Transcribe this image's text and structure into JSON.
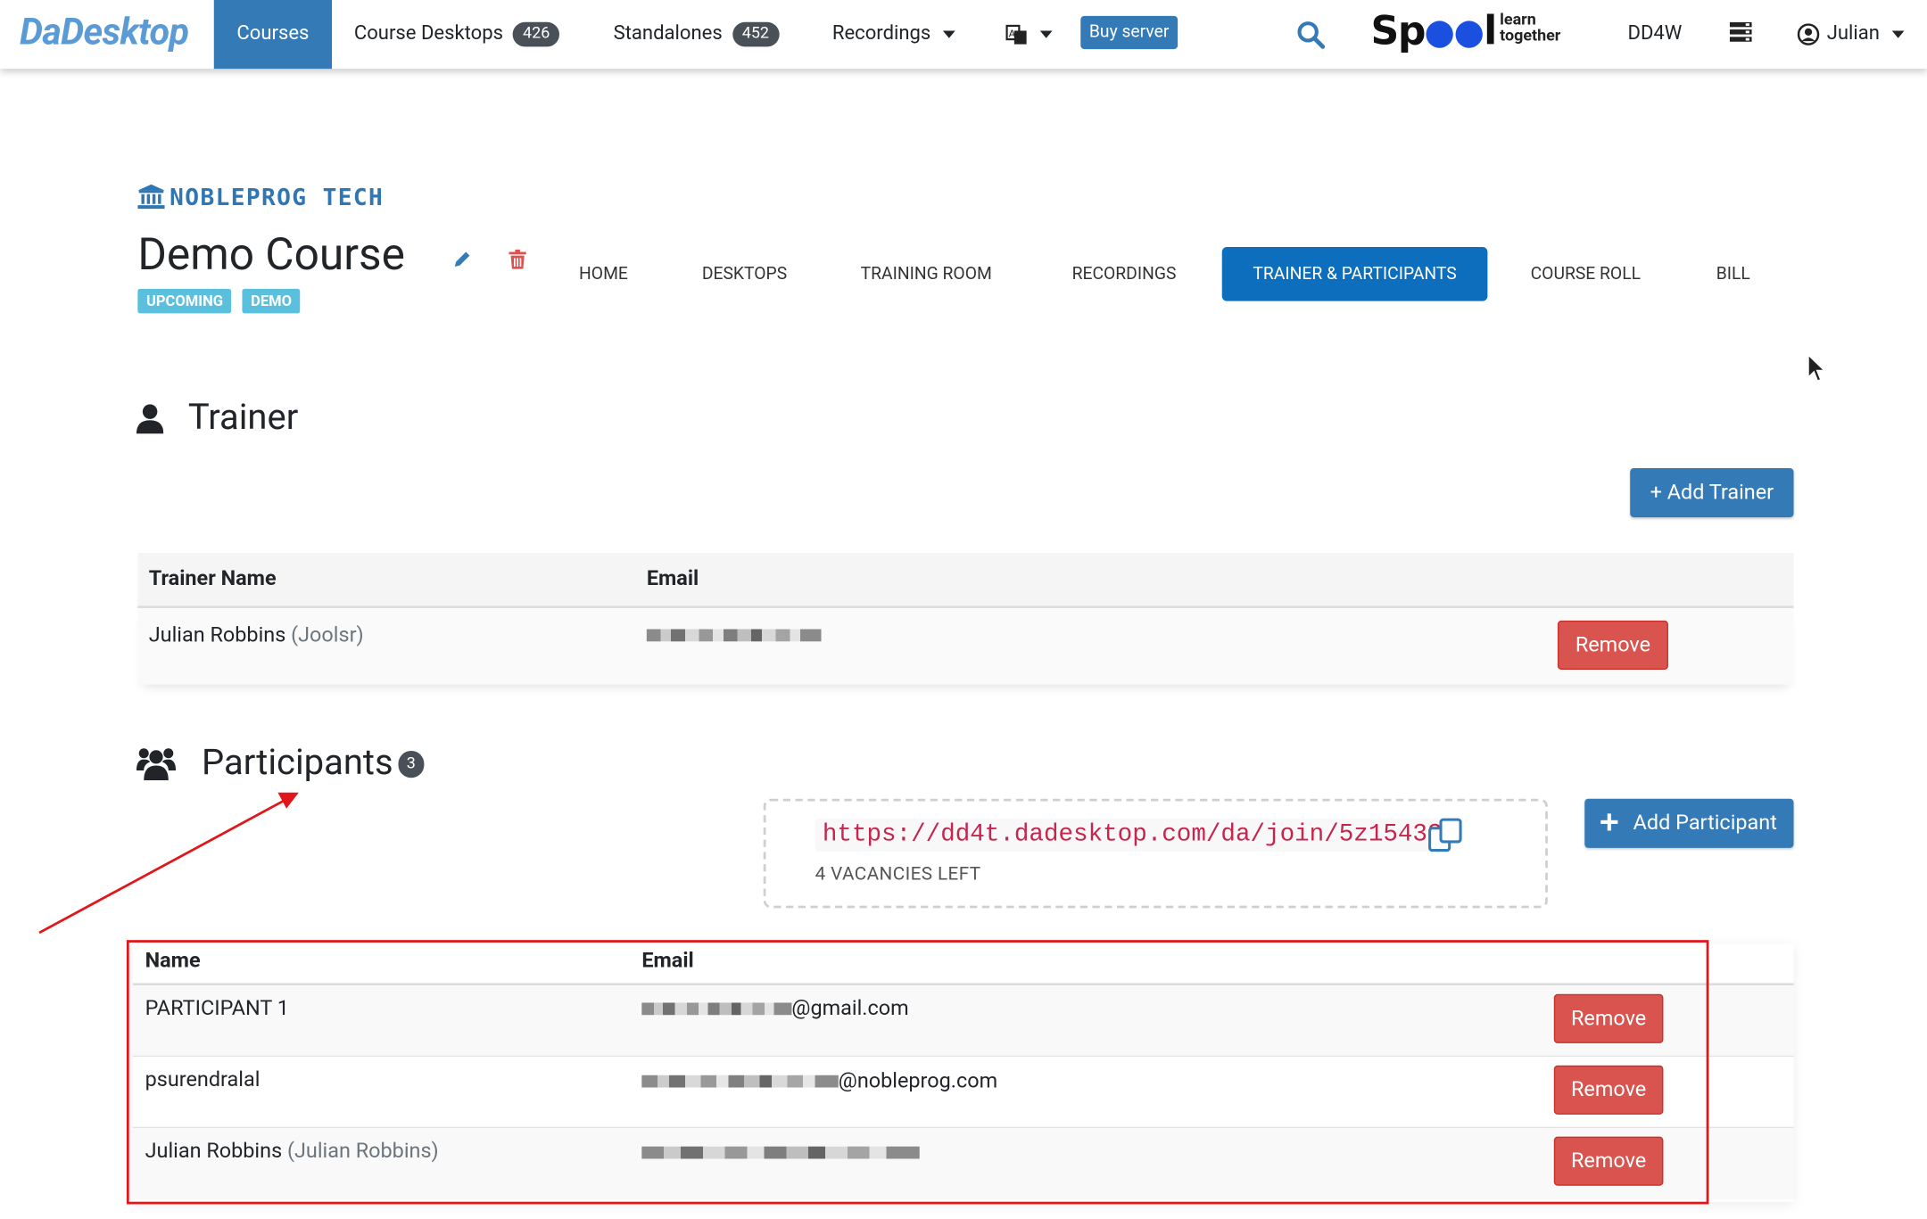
{
  "navbar": {
    "brand": "DaDesktop",
    "items": [
      {
        "label": "Courses"
      },
      {
        "label": "Course Desktops",
        "count": "426"
      },
      {
        "label": "Standalones",
        "count": "452"
      },
      {
        "label": "Recordings"
      }
    ],
    "buy_server": "Buy server",
    "spool_logo": "Spool",
    "spool_tagline_1": "learn",
    "spool_tagline_2": "together",
    "dd4w": "DD4W",
    "user": "Julian"
  },
  "course": {
    "org": "NOBLEPROG TECH",
    "title": "Demo Course",
    "badges": [
      "UPCOMING",
      "DEMO"
    ],
    "tabs": [
      "HOME",
      "DESKTOPS",
      "TRAINING ROOM",
      "RECORDINGS",
      "TRAINER & PARTICIPANTS",
      "COURSE ROLL",
      "BILL"
    ],
    "active_tab": "TRAINER & PARTICIPANTS"
  },
  "trainer": {
    "heading": "Trainer",
    "add_label": "+ Add Trainer",
    "columns": [
      "Trainer Name",
      "Email"
    ],
    "rows": [
      {
        "name": "Julian Robbins",
        "username": "(Joolsr)",
        "remove": "Remove"
      }
    ]
  },
  "participants": {
    "heading": "Participants",
    "count": "3",
    "invite_url": "https://dd4t.dadesktop.com/da/join/5z15433",
    "vacancies": "4 VACANCIES LEFT",
    "add_label": "Add Participant",
    "columns": [
      "Name",
      "Email"
    ],
    "rows": [
      {
        "name": "PARTICIPANT 1",
        "username": "",
        "email_suffix": "@gmail.com",
        "remove": "Remove"
      },
      {
        "name": "psurendralal",
        "username": "",
        "email_suffix": "@nobleprog.com",
        "remove": "Remove"
      },
      {
        "name": "Julian Robbins",
        "username": "(Julian Robbins)",
        "email_suffix": "",
        "remove": "Remove"
      }
    ]
  },
  "colors": {
    "primary": "#337ab7",
    "active_tab": "#0d6ebd",
    "danger": "#d9534f",
    "badge": "#5bc0de",
    "annotation": "#e0161b",
    "invite_link": "#c7254e"
  }
}
